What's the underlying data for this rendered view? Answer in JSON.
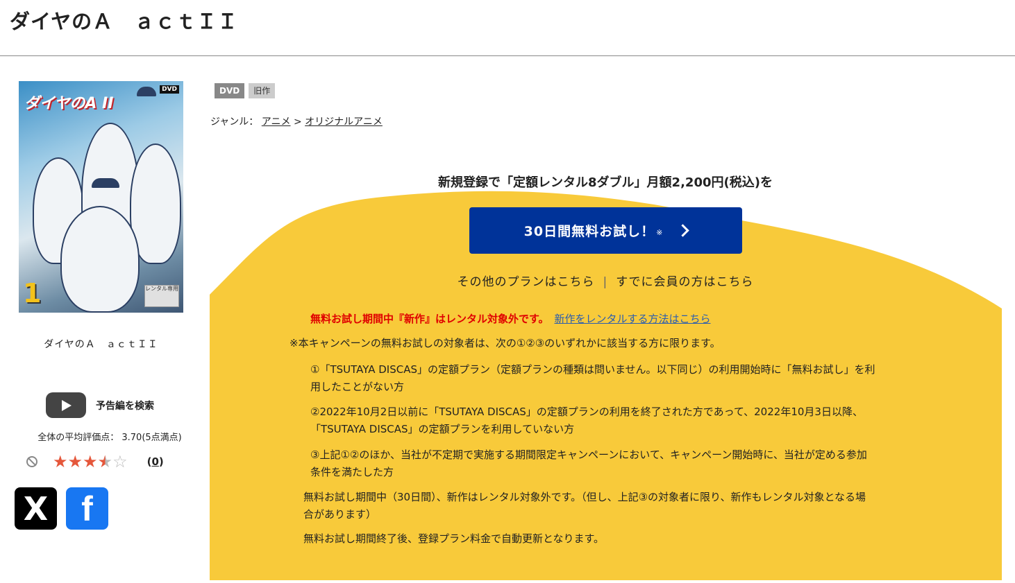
{
  "title": "ダイヤのＡ　ａｃｔＩＩ",
  "cover": {
    "logo_text": "ダイヤのA II",
    "dvd_tag": "DVD",
    "volume": "1",
    "badge": "レンタル専用"
  },
  "caption": "ダイヤのＡ　ａｃｔＩＩ",
  "trailer_label": "予告編を検索",
  "avg_rating_text": "全体の平均評価点： 3.70(5点満点)",
  "rating": {
    "value": 3.7,
    "max": 5,
    "review_count": "(0)",
    "count_link": "0"
  },
  "share": {
    "x": "X",
    "facebook": "f"
  },
  "tags": [
    "DVD",
    "旧作"
  ],
  "genre": {
    "label": "ジャンル：",
    "items": [
      "アニメ",
      "オリジナルアニメ"
    ],
    "sep": ">"
  },
  "promo": {
    "headline": "新規登録で「定額レンタル8ダブル」月額2,200円(税込)を",
    "cta_label": "30日間無料お試し！",
    "cta_mark": "※",
    "other_plans": "その他のプランはこちら",
    "separator": "|",
    "member_link": "すでに会員の方はこちら"
  },
  "notice": {
    "warning": "無料お試し期間中『新作』はレンタル対象外です。",
    "warning_link": "新作をレンタルする方法はこちら",
    "intro": "※本キャンペーンの無料お試しの対象者は、次の①②③のいずれかに該当する方に限ります。",
    "item1_line1": "①「TSUTAYA DISCAS」の定額プラン（定額プランの種類は問いません。以下同じ）の利用開始時に「無料お試し」を利",
    "item1_line2": "用したことがない方",
    "item2_line1": "②2022年10月2日以前に「TSUTAYA DISCAS」の定額プランの利用を終了された方であって、2022年10月3日以降、",
    "item2_line2": "「TSUTAYA DISCAS」の定額プランを利用していない方",
    "item3_line1": "③上記①②のほか、当社が不定期で実施する期間限定キャンペーンにおいて、キャンペーン開始時に、当社が定める参加",
    "item3_line2": "条件を満たした方",
    "period_line1": "無料お試し期間中（30日間）、新作はレンタル対象外です。（但し、上記③の対象者に限り、新作もレンタル対象となる場",
    "period_line2": "合があります）",
    "renewal": "無料お試し期間終了後、登録プラン料金で自動更新となります。"
  },
  "colors": {
    "cta": "#003399",
    "promo_bg": "#f8ca3a",
    "warning": "#e00000",
    "link": "#2a5db0"
  }
}
